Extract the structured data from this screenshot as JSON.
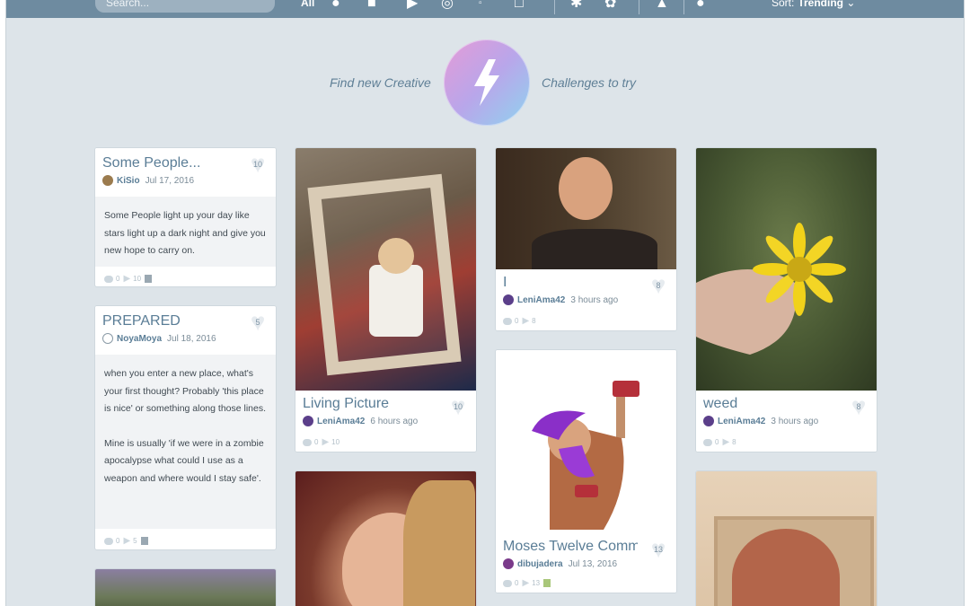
{
  "toolbar": {
    "search_placeholder": "Search...",
    "filter_all": "All",
    "sort_label": "Sort:",
    "sort_value": "Trending"
  },
  "banner": {
    "left_text": "Find new Creative",
    "right_text": "Challenges to try"
  },
  "colors": {
    "topbar": "#6e8ba0",
    "accent": "#5a7d96",
    "background": "#dde4e9"
  },
  "cards": [
    {
      "title": "Some People...",
      "likes": "10",
      "user": "KiSio",
      "date": "Jul 17, 2016",
      "body": "Some People light up your day like stars light up a dark night and give you new hope to carry on.",
      "comments": "0",
      "views": "10"
    },
    {
      "title": "PREPARED",
      "likes": "5",
      "user": "NoyaMoya",
      "date": "Jul 18, 2016",
      "body_p1": "when you enter a new place, what's your first thought? Probably 'this place is nice' or something along those lines.",
      "body_p2": "Mine is usually 'if we were in a zombie apocalypse what could I use as a weapon and where would I stay safe'.",
      "comments": "0",
      "views": "5"
    },
    {
      "title": "Living Picture",
      "likes": "10",
      "user": "LeniAma42",
      "date": "6 hours ago",
      "comments": "0",
      "views": "10"
    },
    {
      "title": "I",
      "likes": "8",
      "user": "LeniAma42",
      "date": "3 hours ago",
      "comments": "0",
      "views": "8"
    },
    {
      "title": "Moses Twelve Comma",
      "likes": "13",
      "user": "dibujadera",
      "date": "Jul 13, 2016",
      "comments": "0",
      "views": "13"
    },
    {
      "title": "weed",
      "likes": "8",
      "user": "LeniAma42",
      "date": "3 hours ago",
      "comments": "0",
      "views": "8"
    }
  ]
}
